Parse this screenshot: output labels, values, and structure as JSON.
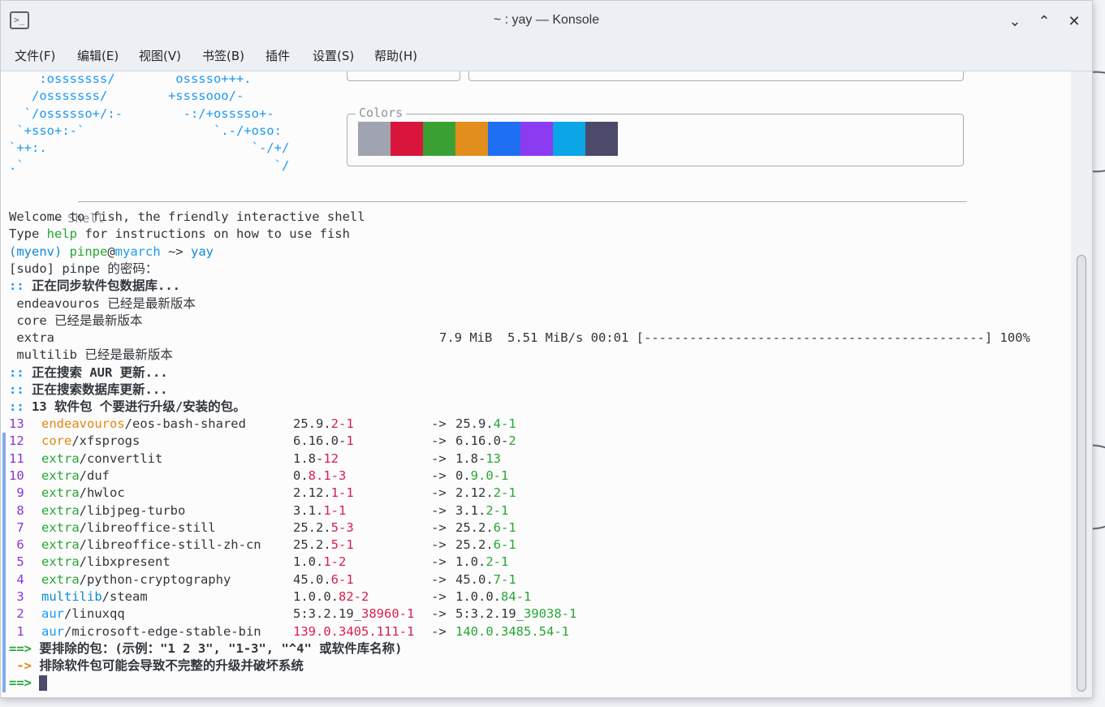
{
  "window": {
    "title": "~ : yay — Konsole",
    "app_icon_glyph": ">_",
    "minimize_glyph": "⌄",
    "maximize_glyph": "⌃",
    "close_glyph": "✕"
  },
  "menu": [
    "文件(F)",
    "编辑(E)",
    "视图(V)",
    "书签(B)",
    "插件",
    "设置(S)",
    "帮助(H)"
  ],
  "ascii_art": [
    "    :osssssss/        osssso+++.",
    "   /osssssss/        +ssssooo/-",
    "  `/ossssso+/:-        -:/+osssso+-",
    " `+sso+:-`                 `.-/+oso:",
    "`++:.                           `-/+/",
    ".`                                 `/"
  ],
  "colors_box": {
    "label": "Colors",
    "swatches": [
      "#a0a4b0",
      "#d8163c",
      "#3aa033",
      "#e28e1c",
      "#1f6ff2",
      "#8b3cf0",
      "#0ba6e8",
      "#4b4a6b"
    ]
  },
  "shell_header": "— Shell",
  "lines": {
    "welcome": "Welcome to fish, the friendly interactive shell",
    "type_pre": "Type ",
    "type_help": "help",
    "type_post": " for instructions on how to use fish",
    "prompt_env": "(myenv) ",
    "prompt_user": "pinpe",
    "prompt_at": "@",
    "prompt_host": "myarch",
    "prompt_cwd": " ~> ",
    "prompt_cmd": "yay",
    "sudo": "[sudo] pinpe 的密码：",
    "sync_marker": "::",
    "sync_text": " 正在同步软件包数据库...",
    "repo1": " endeavouros 已经是最新版本",
    "repo2": " core 已经是最新版本",
    "repo3_name": " extra",
    "repo3_progress": "7.9 MiB  5.51 MiB/s 00:01 [---------------------------------------------] 100%",
    "repo4": " multilib 已经是最新版本",
    "search_aur": " 正在搜索 AUR 更新...",
    "search_db": " 正在搜索数据库更新...",
    "count_line": " 13 软件包 个要进行升级/安装的包。",
    "exclude_prompt": " 要排除的包：(示例：\"1 2 3\", \"1-3\", \"^4\" 或软件库名称)",
    "exclude_warn": " 排除软件包可能会导致不完整的升级并破坏系统",
    "arrow_marker": "==>",
    "warn_marker": " ->",
    "final_marker": "==> "
  },
  "packages": [
    {
      "n": "13",
      "repo": "endeavouros",
      "repo_color": "orange",
      "name": "eos-bash-shared",
      "old_base": "25.9.",
      "old_diff": "2-1",
      "new_base": "25.9.",
      "new_diff": "4-1"
    },
    {
      "n": "12",
      "repo": "core",
      "repo_color": "orange",
      "name": "xfsprogs",
      "old_base": "6.16.0-",
      "old_diff": "1",
      "new_base": "6.16.0-",
      "new_diff": "2"
    },
    {
      "n": "11",
      "repo": "extra",
      "repo_color": "green",
      "name": "convertlit",
      "old_base": "1.8-",
      "old_diff": "12",
      "new_base": "1.8-",
      "new_diff": "13"
    },
    {
      "n": "10",
      "repo": "extra",
      "repo_color": "green",
      "name": "duf",
      "old_base": "0.",
      "old_diff": "8.1-3",
      "new_base": "0.",
      "new_diff": "9.0-1"
    },
    {
      "n": " 9",
      "repo": "extra",
      "repo_color": "green",
      "name": "hwloc",
      "old_base": "2.12.",
      "old_diff": "1-1",
      "new_base": "2.12.",
      "new_diff": "2-1"
    },
    {
      "n": " 8",
      "repo": "extra",
      "repo_color": "green",
      "name": "libjpeg-turbo",
      "old_base": "3.1.",
      "old_diff": "1-1",
      "new_base": "3.1.",
      "new_diff": "2-1"
    },
    {
      "n": " 7",
      "repo": "extra",
      "repo_color": "green",
      "name": "libreoffice-still",
      "old_base": "25.2.",
      "old_diff": "5-3",
      "new_base": "25.2.",
      "new_diff": "6-1"
    },
    {
      "n": " 6",
      "repo": "extra",
      "repo_color": "green",
      "name": "libreoffice-still-zh-cn",
      "old_base": "25.2.",
      "old_diff": "5-1",
      "new_base": "25.2.",
      "new_diff": "6-1"
    },
    {
      "n": " 5",
      "repo": "extra",
      "repo_color": "green",
      "name": "libxpresent",
      "old_base": "1.0.",
      "old_diff": "1-2",
      "new_base": "1.0.",
      "new_diff": "2-1"
    },
    {
      "n": " 4",
      "repo": "extra",
      "repo_color": "green",
      "name": "python-cryptography",
      "old_base": "45.0.",
      "old_diff": "6-1",
      "new_base": "45.0.",
      "new_diff": "7-1"
    },
    {
      "n": " 3",
      "repo": "multilib",
      "repo_color": "cyan",
      "name": "steam",
      "old_base": "1.0.0.",
      "old_diff": "82-2",
      "new_base": "1.0.0.",
      "new_diff": "84-1"
    },
    {
      "n": " 2",
      "repo": "aur",
      "repo_color": "blue",
      "name": "linuxqq",
      "old_base": "5:3.2.19_",
      "old_diff": "38960-1",
      "new_base": "5:3.2.19_",
      "new_diff": "39038-1"
    },
    {
      "n": " 1",
      "repo": "aur",
      "repo_color": "blue",
      "name": "microsoft-edge-stable-bin",
      "old_base": "",
      "old_diff": "139.0.3405.111-1",
      "new_base": "",
      "new_diff": "140.0.3485.54-1"
    }
  ],
  "arrow": "->"
}
